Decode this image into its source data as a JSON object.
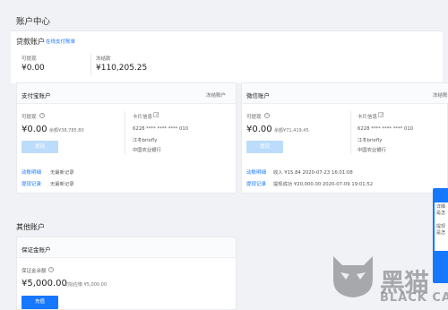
{
  "page_title": "账户中心",
  "loan_account": {
    "title": "贷款账户",
    "link": "在线支付账单",
    "withdrawable_label": "可提现",
    "withdrawable_value": "¥0.00",
    "frozen_label": "冻结款",
    "frozen_value": "¥110,205.25"
  },
  "alipay": {
    "title": "支付宝账户",
    "freeze_link": "冻结账户",
    "withdrawable_label": "可提现",
    "amount": "¥0.00",
    "balance": "余额¥38,785.80",
    "card_label": "卡片信息",
    "card_number": "6228 **** **** **** 010",
    "card_name": "江冬briefly",
    "bank": "中国农业银行",
    "withdraw_button": "提现",
    "detail_link": "动账明细",
    "detail_value": "无最新记录",
    "withdraw_record_link": "提现记录",
    "withdraw_record_value": "无最新记录"
  },
  "wechat": {
    "title": "微信账户",
    "freeze_link": "冻结账",
    "withdrawable_label": "可提现",
    "amount": "¥0.00",
    "balance": "余额¥71,419.45",
    "card_label": "卡片信息",
    "card_number": "6228 **** **** **** 010",
    "card_name": "江冬briefly",
    "bank": "中国农业银行",
    "withdraw_button": "提现",
    "detail_link": "动账明细",
    "detail_value": "收入 ¥15.84 2020-07-23 16:01:08",
    "withdraw_record_link": "提现记录",
    "withdraw_record_value": "提现成功 ¥20,000.00 2020-07-09 19:01:52"
  },
  "other_accounts": {
    "title": "其他账户",
    "deposit_title": "保证金账户",
    "deposit_label": "保证金余额",
    "deposit_value": "¥5,000.00",
    "initial_label": "初始应缴 ¥5,000.00",
    "recharge_button": "充值"
  },
  "side_widget": {
    "lines": [
      "详细",
      "是怎",
      "提现",
      "是怎"
    ]
  },
  "watermark": {
    "text_cn": "黑猫",
    "text_en": "BLACK CAT"
  }
}
